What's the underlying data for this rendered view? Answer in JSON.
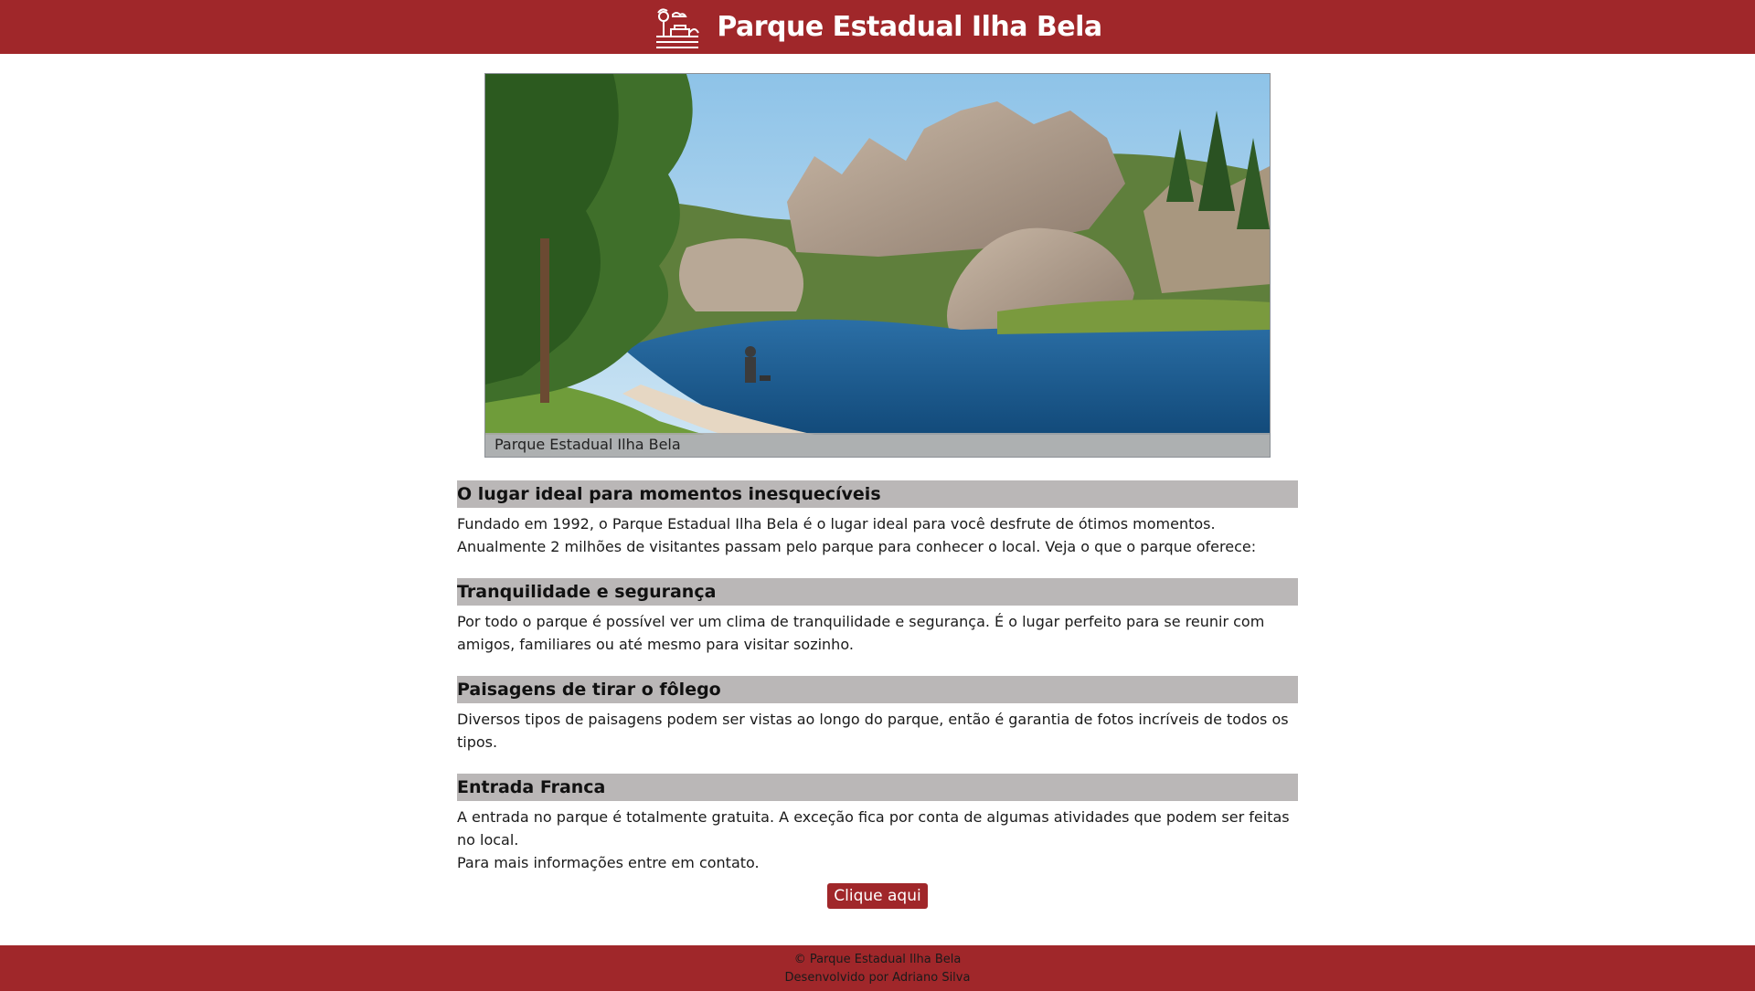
{
  "header": {
    "logo_icon": "park-logo-icon",
    "title": "Parque Estadual Ilha Bela"
  },
  "hero": {
    "image_description_icon": "lake-landscape-image",
    "caption": "Parque Estadual Ilha Bela"
  },
  "sections": [
    {
      "title": "O lugar ideal para momentos inesquecíveis",
      "paragraphs": [
        "Fundado em 1992, o Parque Estadual Ilha Bela é o lugar ideal para você desfrute de ótimos momentos.",
        "Anualmente 2 milhões de visitantes passam pelo parque para conhecer o local. Veja o que o parque oferece:"
      ]
    },
    {
      "title": "Tranquilidade e segurança",
      "paragraphs": [
        "Por todo o parque é possível ver um clima de tranquilidade e segurança. É o lugar perfeito para se reunir com amigos, familiares ou até mesmo para visitar sozinho."
      ]
    },
    {
      "title": "Paisagens de tirar o fôlego",
      "paragraphs": [
        "Diversos tipos de paisagens podem ser vistas ao longo do parque, então é garantia de fotos incríveis de todos os tipos."
      ]
    },
    {
      "title": "Entrada Franca",
      "paragraphs": [
        "A entrada no parque é totalmente gratuita. A exceção fica por conta de algumas atividades que podem ser feitas no local.",
        "Para mais informações entre em contato."
      ]
    }
  ],
  "cta": {
    "label": "Clique aqui"
  },
  "footer": {
    "copyright": "© Parque Estadual Ilha Bela",
    "credit": "Desenvolvido por Adriano Silva"
  },
  "colors": {
    "brand": "#a0272a",
    "section_heading_bg": "#bab7b7"
  }
}
